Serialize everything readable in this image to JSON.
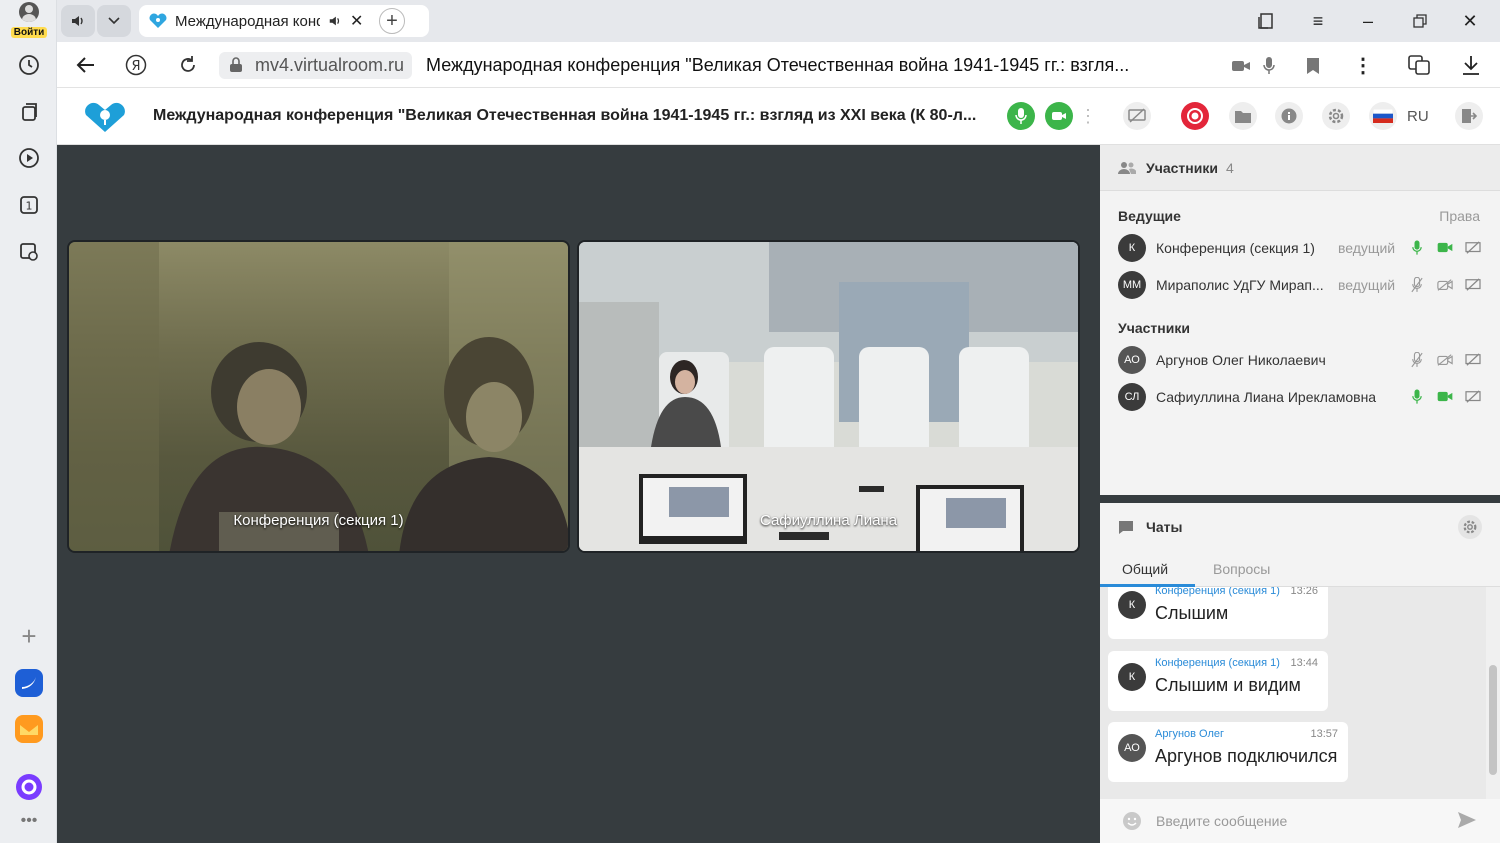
{
  "browser": {
    "login_label": "Войти",
    "tab_title": "Международная конференция",
    "domain": "mv4.virtualroom.ru",
    "page_title": "Международная конференция \"Великая Отечественная война 1941-1945 гг.: взгля..."
  },
  "app": {
    "title": "Международная конференция \"Великая Отечественная война 1941-1945 гг.: взгляд из XXI века (К 80-л...",
    "language": "RU",
    "colors": {
      "accent_green": "#3cb54a",
      "record_red": "#e3263a",
      "stage_bg": "#363c3f",
      "link_blue": "#2a8bd8"
    }
  },
  "stage": {
    "tiles": [
      {
        "name": "Конференция (секция 1)"
      },
      {
        "name": "Сафиуллина Лиана"
      }
    ]
  },
  "participants": {
    "header": "Участники",
    "count": "4",
    "rights_label": "Права",
    "hosts_label": "Ведущие",
    "members_label": "Участники",
    "hosts": [
      {
        "initials": "К",
        "name": "Конференция (секция 1)",
        "role": "ведущий",
        "mic": "on",
        "cam": "on"
      },
      {
        "initials": "ММ",
        "name": "Мираполис УдГУ Мирап...",
        "role": "ведущий",
        "mic": "off",
        "cam": "off"
      }
    ],
    "members": [
      {
        "initials": "АО",
        "name": "Аргунов Олег Николаевич",
        "mic": "off",
        "cam": "off"
      },
      {
        "initials": "СЛ",
        "name": "Сафиуллина Лиана Ирекламовна",
        "mic": "on",
        "cam": "on"
      }
    ]
  },
  "chat": {
    "header": "Чаты",
    "tabs": [
      "Общий",
      "Вопросы"
    ],
    "messages": [
      {
        "initials": "К",
        "author": "Конференция (секция 1)",
        "time": "13:26",
        "text": "Слышим"
      },
      {
        "initials": "К",
        "author": "Конференция (секция 1)",
        "time": "13:44",
        "text": "Слышим и видим"
      },
      {
        "initials": "АО",
        "author": "Аргунов Олег",
        "time": "13:57",
        "text": "Аргунов подключился"
      }
    ],
    "input_placeholder": "Введите сообщение"
  }
}
